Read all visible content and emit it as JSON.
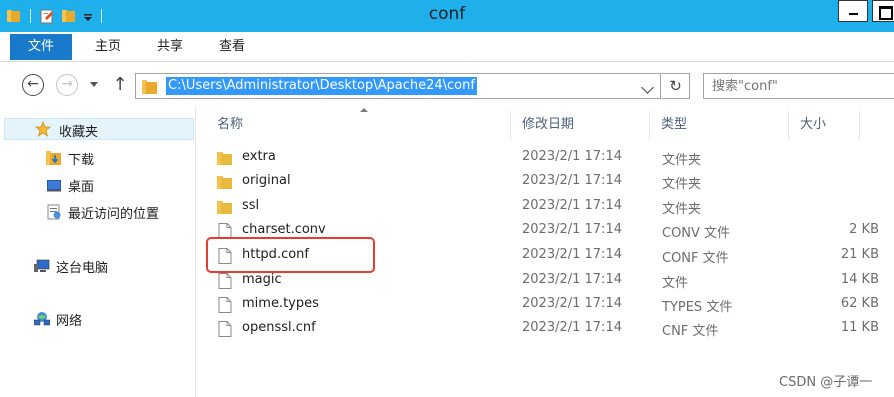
{
  "window": {
    "title": "conf"
  },
  "ribbon": {
    "tabs": [
      "文件",
      "主页",
      "共享",
      "查看"
    ]
  },
  "address": {
    "path": "C:\\Users\\Administrator\\Desktop\\Apache24\\conf",
    "search_placeholder": "搜索\"conf\""
  },
  "nav": {
    "favorites": "收藏夹",
    "downloads": "下载",
    "desktop": "桌面",
    "recent": "最近访问的位置",
    "this_pc": "这台电脑",
    "network": "网络"
  },
  "columns": {
    "name": "名称",
    "date": "修改日期",
    "type": "类型",
    "size": "大小"
  },
  "files": [
    {
      "name": "extra",
      "date": "2023/2/1 17:14",
      "type": "文件夹",
      "size": "",
      "icon": "folder-icon"
    },
    {
      "name": "original",
      "date": "2023/2/1 17:14",
      "type": "文件夹",
      "size": "",
      "icon": "folder-icon"
    },
    {
      "name": "ssl",
      "date": "2023/2/1 17:14",
      "type": "文件夹",
      "size": "",
      "icon": "folder-icon"
    },
    {
      "name": "charset.conv",
      "date": "2023/2/1 17:14",
      "type": "CONV 文件",
      "size": "2 KB",
      "icon": "file-icon"
    },
    {
      "name": "httpd.conf",
      "date": "2023/2/1 17:14",
      "type": "CONF 文件",
      "size": "21 KB",
      "icon": "file-icon"
    },
    {
      "name": "magic",
      "date": "2023/2/1 17:14",
      "type": "文件",
      "size": "14 KB",
      "icon": "file-icon"
    },
    {
      "name": "mime.types",
      "date": "2023/2/1 17:14",
      "type": "TYPES 文件",
      "size": "62 KB",
      "icon": "file-icon"
    },
    {
      "name": "openssl.cnf",
      "date": "2023/2/1 17:14",
      "type": "CNF 文件",
      "size": "11 KB",
      "icon": "file-icon"
    }
  ],
  "watermark": "CSDN @子谭一",
  "colors": {
    "titlebar": "#1fb0ec",
    "file_tab": "#1979ca",
    "selection": "#3399ff",
    "highlight_box": "#e83b32",
    "folder": "#e8b93c"
  }
}
